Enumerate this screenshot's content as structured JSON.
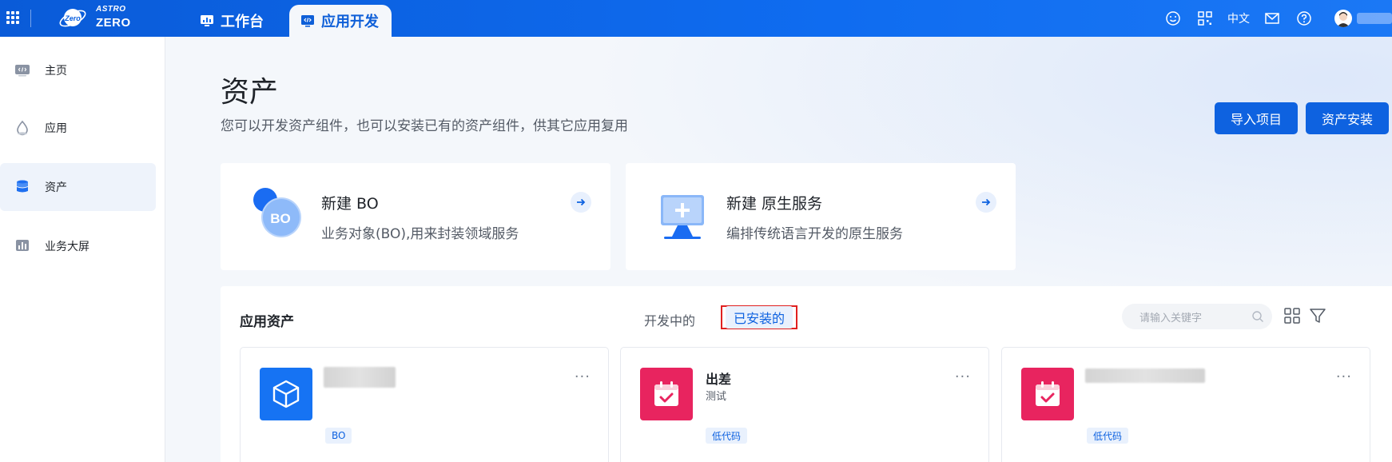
{
  "header": {
    "brand_small": "ASTRO",
    "brand_name": "ZERO",
    "logo_badge": "Zero",
    "tabs": [
      {
        "label": "工作台",
        "active": false
      },
      {
        "label": "应用开发",
        "active": true
      }
    ],
    "language": "中文",
    "icons": [
      "smile-icon",
      "qrcode-icon",
      "mail-icon",
      "help-icon"
    ]
  },
  "sidebar": {
    "items": [
      {
        "label": "主页",
        "icon": "code-page-icon",
        "active": false
      },
      {
        "label": "应用",
        "icon": "app-drop-icon",
        "active": false
      },
      {
        "label": "资产",
        "icon": "database-icon",
        "active": true
      },
      {
        "label": "业务大屏",
        "icon": "bar-chart-icon",
        "active": false
      }
    ]
  },
  "page": {
    "title": "资产",
    "description": "您可以开发资产组件，也可以安装已有的资产组件，供其它应用复用",
    "import_button": "导入项目",
    "install_button": "资产安装"
  },
  "quick_cards": [
    {
      "title": "新建 BO",
      "description": "业务对象(BO),用来封装领域服务",
      "icon_text": "BO"
    },
    {
      "title": "新建 原生服务",
      "description": "编排传统语言开发的原生服务"
    }
  ],
  "assets_panel": {
    "title": "应用资产",
    "segments": [
      "开发中的",
      "已安装的"
    ],
    "active_segment": "已安装的",
    "search_placeholder": "请输入关键字",
    "cards": [
      {
        "name": "",
        "subtitle": "",
        "tag": "BO",
        "icon": "cube-icon",
        "color": "#1673f3"
      },
      {
        "name": "出差",
        "subtitle": "测试",
        "tag": "低代码",
        "icon": "calendar-check-icon",
        "color": "#e8245f"
      },
      {
        "name": "",
        "subtitle": "",
        "tag": "低代码",
        "icon": "calendar-check-icon",
        "color": "#e8245f"
      }
    ],
    "more_glyph": "···"
  },
  "colors": {
    "primary": "#0e62e0",
    "header": "#0f6cf0",
    "highlight_border": "#e02020",
    "pink": "#e8245f"
  }
}
